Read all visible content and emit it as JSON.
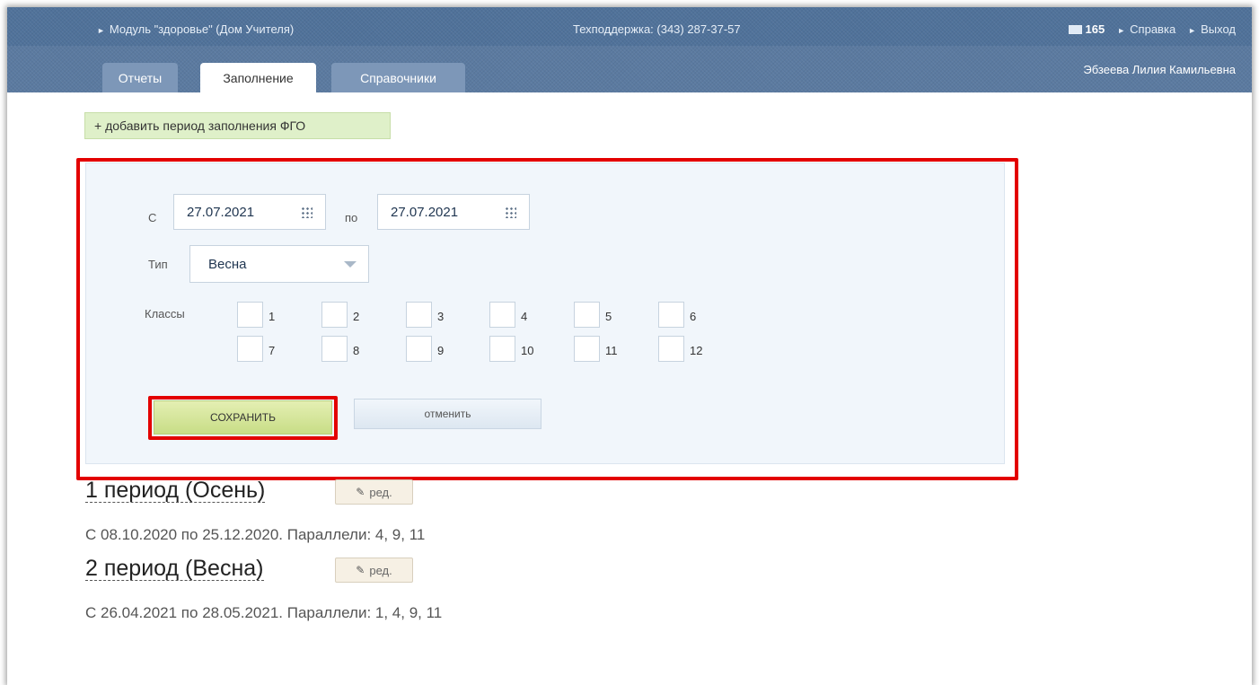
{
  "header": {
    "module": "Модуль \"здоровье\" (Дом Учителя)",
    "support": "Техподдержка: (343) 287-37-57",
    "message_count": "165",
    "help": "Справка",
    "logout": "Выход",
    "user_name": "Эбзеева Лилия Камильевна"
  },
  "tabs": [
    {
      "label": "Отчеты"
    },
    {
      "label": "Заполнение",
      "active": true
    },
    {
      "label": "Справочники"
    }
  ],
  "add_period_button": "+ добавить период заполнения ФГО",
  "form": {
    "from_label": "С",
    "from_date": "27.07.2021",
    "to_label": "по",
    "to_date": "27.07.2021",
    "type_label": "Тип",
    "type_value": "Весна",
    "classes_label": "Классы",
    "classes": [
      "1",
      "2",
      "3",
      "4",
      "5",
      "6",
      "7",
      "8",
      "9",
      "10",
      "11",
      "12"
    ],
    "save_button": "СОХРАНИТЬ",
    "cancel_button": "отменить"
  },
  "periods": [
    {
      "title": "1 период (Осень)",
      "edit": "ред.",
      "description": "С 08.10.2020 по 25.12.2020. Параллели: 4, 9, 11"
    },
    {
      "title": "2 период (Весна)",
      "edit": "ред.",
      "description": "С 26.04.2021 по 28.05.2021. Параллели: 1, 4, 9, 11"
    }
  ],
  "colors": {
    "header_bg": "#50729a",
    "highlight_red": "#e30000",
    "save_green": "#c8dd86"
  }
}
